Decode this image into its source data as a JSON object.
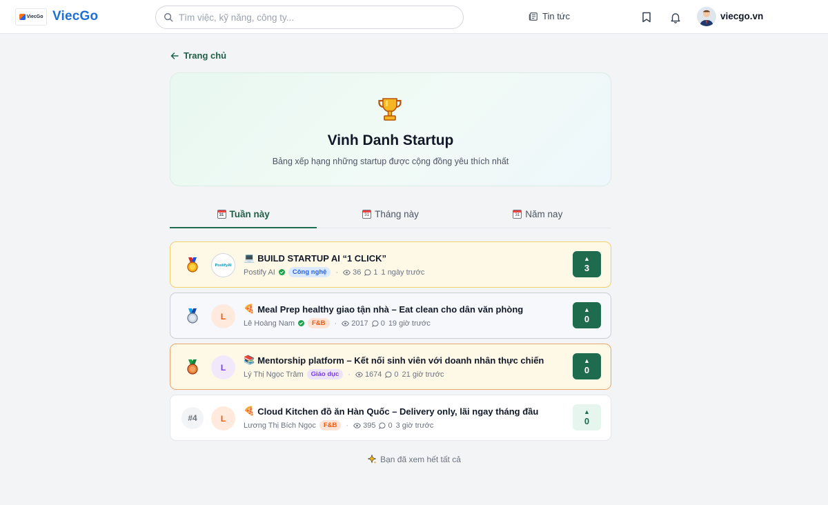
{
  "header": {
    "brand": "ViecGo",
    "logo_text": "ViecGo",
    "search_placeholder": "Tìm việc, kỹ năng, công ty...",
    "news_label": "Tin tức",
    "username": "viecgo.vn"
  },
  "back_label": "Trang chủ",
  "hero": {
    "title": "Vinh Danh Startup",
    "subtitle": "Bảng xếp hạng những startup được cộng đồng yêu thích nhất"
  },
  "tabs": [
    {
      "label": "Tuần này",
      "active": true,
      "cal": "31"
    },
    {
      "label": "Tháng này",
      "active": false,
      "cal": "31"
    },
    {
      "label": "Năm nay",
      "active": false,
      "cal": "31"
    }
  ],
  "posts": [
    {
      "rank": "#1",
      "medal": "gold",
      "emoji": "💻",
      "avatar": "PostifyAI",
      "title": "BUILD STARTUP AI “1 CLICK”",
      "author": "Postify AI",
      "verified": true,
      "tag": "Công nghệ",
      "views": "36",
      "comments": "1",
      "time": "1 ngày trước",
      "votes": "3"
    },
    {
      "rank": "#2",
      "medal": "silver",
      "emoji": "🍕",
      "avatar": "L",
      "title": "Meal Prep healthy giao tận nhà – Eat clean cho dân văn phòng",
      "author": "Lê Hoàng Nam",
      "verified": true,
      "tag": "F&B",
      "views": "2017",
      "comments": "0",
      "time": "19 giờ trước",
      "votes": "0"
    },
    {
      "rank": "#3",
      "medal": "bronze",
      "emoji": "📚",
      "avatar": "L",
      "title": "Mentorship platform – Kết nối sinh viên với doanh nhân thực chiến",
      "author": "Lý Thị Ngọc Trâm",
      "verified": false,
      "tag": "Giáo dục",
      "views": "1674",
      "comments": "0",
      "time": "21 giờ trước",
      "votes": "0"
    },
    {
      "rank": "#4",
      "medal": "none",
      "emoji": "🍕",
      "avatar": "L",
      "title": "Cloud Kitchen đồ ăn Hàn Quốc – Delivery only, lãi ngay tháng đầu",
      "author": "Lương Thị Bích Ngọc",
      "verified": false,
      "tag": "F&B",
      "views": "395",
      "comments": "0",
      "time": "3 giờ trước",
      "votes": "0"
    }
  ],
  "end_note": "Bạn đã xem hết tất cả",
  "colors": {
    "brand_blue": "#1d6fd8",
    "primary_green": "#1e6b4d",
    "gold_border": "#f1cf6a",
    "silver_border": "#c9ced6",
    "bronze_border": "#e9a66b"
  },
  "icons": {
    "search": "search-icon",
    "news": "newspaper-icon",
    "bookmark": "bookmark-icon",
    "bell": "bell-icon",
    "back": "arrow-left-icon",
    "trophy": "trophy-icon",
    "views": "eye-icon",
    "comments": "comment-icon",
    "upvote": "triangle-up-icon"
  }
}
